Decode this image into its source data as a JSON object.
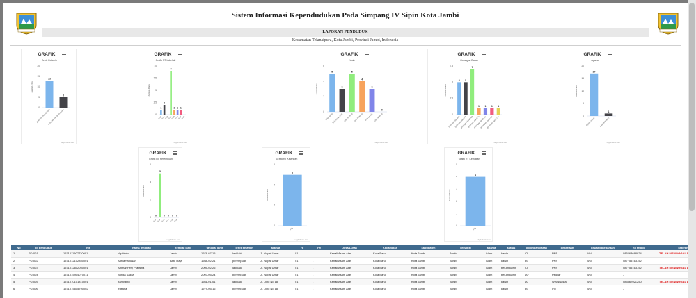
{
  "header": {
    "title": "Sistem Informasi Kependudukan Pada Simpang IV Sipin Kota Jambi",
    "report_label": "LAPORAN PENDUDUK",
    "address": "Kecamatan Telanaipura, Kota Jambi, Provinsi Jambi, Indonesia"
  },
  "colors": {
    "blue": "#7cb5ec",
    "black": "#434348",
    "green": "#90ed7d",
    "orange": "#f7a35c",
    "purple": "#8085e9",
    "pink": "#f15c80",
    "red": "#e4d354",
    "header_blue": "#3f6a8e",
    "dead_text": "#dd1111"
  },
  "icons": {
    "logo": "jambi-city-emblem",
    "menu": "hamburger-menu-icon"
  },
  "credit": "Highcharts.com",
  "chart_data": [
    {
      "id": "jk",
      "type": "bar",
      "heading": "GRAFIK",
      "title": "Jenis Kelamin",
      "ylabel": "Jumlah Data",
      "ylim": [
        0,
        20
      ],
      "yticks": [
        0,
        5,
        10,
        15,
        20
      ],
      "categories": [
        "jenis kelamin laki-laki",
        "jenis kelamin perempuan"
      ],
      "values": [
        13,
        5
      ],
      "colors": [
        "#7cb5ec",
        "#434348"
      ],
      "labels": [
        "13",
        "5"
      ]
    },
    {
      "id": "rtl",
      "type": "bar",
      "heading": "GRAFIK",
      "title": "Grafik RT Laki-laki",
      "ylabel": "Jumlah Data",
      "ylim": [
        0,
        10
      ],
      "yticks": [
        0,
        2.5,
        5,
        7.5,
        10
      ],
      "categories": [
        "rt 01",
        "rt 02",
        "rt 03",
        "rt 04",
        "rt 05",
        "rt 06",
        "rt 07",
        "rt 08"
      ],
      "values": [
        1,
        2,
        0,
        9,
        1,
        1,
        1,
        0
      ],
      "colors": [
        "#7cb5ec",
        "#434348",
        "#90ed7d",
        "#90ed7d",
        "#f7a35c",
        "#8085e9",
        "#f15c80",
        "#7cb5ec"
      ],
      "labels": [
        "1",
        "2",
        "",
        "9",
        "1",
        "1",
        "1",
        ""
      ]
    },
    {
      "id": "usia",
      "type": "bar",
      "heading": "GRAFIK",
      "title": "Usia",
      "ylabel": "Jumlah Data",
      "ylim": [
        0,
        6
      ],
      "yticks": [
        0,
        2,
        4,
        6
      ],
      "categories": [
        "Usia Balita",
        "Usia Anak-anak",
        "Usia Remaja",
        "Usia Dewasa",
        "Usia Lansia",
        "Usia Manula"
      ],
      "values": [
        5,
        3,
        5,
        4,
        3,
        0
      ],
      "colors": [
        "#7cb5ec",
        "#434348",
        "#90ed7d",
        "#f7a35c",
        "#8085e9",
        "#f15c80"
      ],
      "labels": [
        "5",
        "3",
        "5",
        "4",
        "3",
        "0"
      ]
    },
    {
      "id": "gd",
      "type": "bar",
      "heading": "GRAFIK",
      "title": "Golongan Darah",
      "ylabel": "Jumlah Data",
      "ylim": [
        0,
        7.5
      ],
      "yticks": [
        0,
        2.5,
        5,
        7.5
      ],
      "categories": [
        "golongan darah A",
        "golongan darah B",
        "golongan darah AB",
        "golongan darah O",
        "golongan darah A+",
        "golongan darah B+",
        "golongan darah O+"
      ],
      "values": [
        5,
        5,
        7,
        1,
        1,
        1,
        1
      ],
      "colors": [
        "#7cb5ec",
        "#434348",
        "#90ed7d",
        "#f7a35c",
        "#8085e9",
        "#f15c80",
        "#e4d354"
      ],
      "labels": [
        "5",
        "5",
        "7",
        "1",
        "1",
        "1",
        "1"
      ]
    },
    {
      "id": "agama",
      "type": "bar",
      "heading": "GRAFIK",
      "title": "Agama",
      "ylabel": "Jumlah Data",
      "ylim": [
        0,
        20
      ],
      "yticks": [
        0,
        5,
        10,
        15,
        20
      ],
      "categories": [
        "Agama Islam",
        "Agama Kristen"
      ],
      "values": [
        17,
        1
      ],
      "colors": [
        "#7cb5ec",
        "#434348"
      ],
      "labels": [
        "17",
        "1"
      ]
    },
    {
      "id": "rtp",
      "type": "bar",
      "heading": "GRAFIK",
      "title": "Grafik RT Perempuan",
      "ylabel": "Jumlah Data",
      "ylim": [
        0,
        6
      ],
      "yticks": [
        0,
        2,
        4,
        6
      ],
      "categories": [
        "rt 01",
        "rt 02",
        "rt 03",
        "rt 04",
        "rt 05",
        "rt 06"
      ],
      "values": [
        0,
        5,
        0,
        0,
        0,
        0
      ],
      "colors": [
        "#7cb5ec",
        "#90ed7d",
        "#f7a35c",
        "#8085e9",
        "#f15c80",
        "#e4d354"
      ],
      "labels": [
        "0",
        "5",
        "0",
        "0",
        "0",
        "0"
      ]
    },
    {
      "id": "kel",
      "type": "bar",
      "heading": "GRAFIK",
      "title": "Grafik RT Kelahiran",
      "ylabel": "Jumlah Data",
      "ylim": [
        0,
        6
      ],
      "yticks": [
        0,
        2,
        4,
        6
      ],
      "categories": [
        "rt 01"
      ],
      "values": [
        5
      ],
      "colors": [
        "#7cb5ec"
      ],
      "labels": [
        "5"
      ]
    },
    {
      "id": "kem",
      "type": "bar",
      "heading": "GRAFIK",
      "title": "Grafik RT Kematian",
      "ylabel": "Jumlah Data",
      "ylim": [
        0,
        5
      ],
      "yticks": [
        0,
        1,
        2,
        3,
        4,
        5
      ],
      "categories": [
        "rt 01"
      ],
      "values": [
        4
      ],
      "colors": [
        "#7cb5ec"
      ],
      "labels": [
        "4"
      ]
    }
  ],
  "table": {
    "columns": [
      "No",
      "Id penduduk",
      "nik",
      "nama lengkap",
      "tempat lahir",
      "tanggal lahir",
      "jenis kelamin",
      "alamat",
      "rt",
      "rw",
      "Desa/Lurah",
      "Kecamatan",
      "kabupaten",
      "provinsi",
      "agama",
      "status",
      "golongan darah",
      "pekerjaan",
      "kewarganegaraan",
      "no telpon",
      "keterangan"
    ],
    "rows": [
      [
        "1",
        "PD-001",
        "1571011507730001",
        "Ngatimin",
        "Jambi",
        "1978-07-15",
        "laki-laki",
        "Jl. Nopal Umar",
        "01",
        "-",
        "Kenali Asam Atas",
        "Kota Baru",
        "Kota Jambi",
        "Jambi",
        "islam",
        "kawin",
        "O",
        "PNS",
        "WNI",
        "085268688924",
        "TELAH MENINGGAL DUNIA"
      ],
      [
        "2",
        "PD-002",
        "1571012102850001",
        "Adrilamanusan",
        "Batu Raja",
        "1988-02-21",
        "perempuan",
        "Jl. Nopal Umar",
        "01",
        "-",
        "Kenali Asam Atas",
        "Kota Baru",
        "Kota Jambi",
        "Jambi",
        "islam",
        "kawin",
        "B",
        "PNS",
        "WNI",
        "087755163752",
        ""
      ],
      [
        "3",
        "PD-003",
        "1571012602050001",
        "Ammar Fery Pratama",
        "Jambi",
        "2005-02-26",
        "laki-laki",
        "Jl. Nopal Umar",
        "01",
        "-",
        "Kenali Asam Atas",
        "Kota Baru",
        "Kota Jambi",
        "Jambi",
        "islam",
        "belum kawin",
        "O",
        "PNS",
        "WNI",
        "087755163752",
        "TELAH MENINGGAL DUNIA"
      ],
      [
        "4",
        "PD-004",
        "1571015904070011",
        "Bunga Sakila",
        "Jambi",
        "2007-05-24",
        "perempuan",
        "Jl. Nopal Umar",
        "01",
        "-",
        "Kenali Asam Atas",
        "Kota Baru",
        "Kota Jambi",
        "Jambi",
        "islam",
        "belum kawin",
        "A+",
        "Pelajar",
        "WNI",
        "-",
        ""
      ],
      [
        "5",
        "PD-005",
        "1571070101810001",
        "Yamyanto",
        "Jambi",
        "1981-01-01",
        "laki-laki",
        "Jl. Dibo No 18",
        "01",
        "-",
        "Kenali Asam Atas",
        "Kota Baru",
        "Kota Jambi",
        "Jambi",
        "islam",
        "kawin",
        "A",
        "Wiraswasta",
        "WNI",
        "085367021250",
        "TELAH MENINGGAL DUNIA"
      ],
      [
        "6",
        "PD-006",
        "1571075605790002",
        "Yusana",
        "Jambi",
        "1979-05-16",
        "perempuan",
        "Jl. Dibo No 18",
        "01",
        "-",
        "Kenali Asam Atas",
        "Kota Baru",
        "Kota Jambi",
        "Jambi",
        "islam",
        "kawin",
        "B",
        "IRT",
        "WNI",
        "-",
        ""
      ]
    ]
  }
}
